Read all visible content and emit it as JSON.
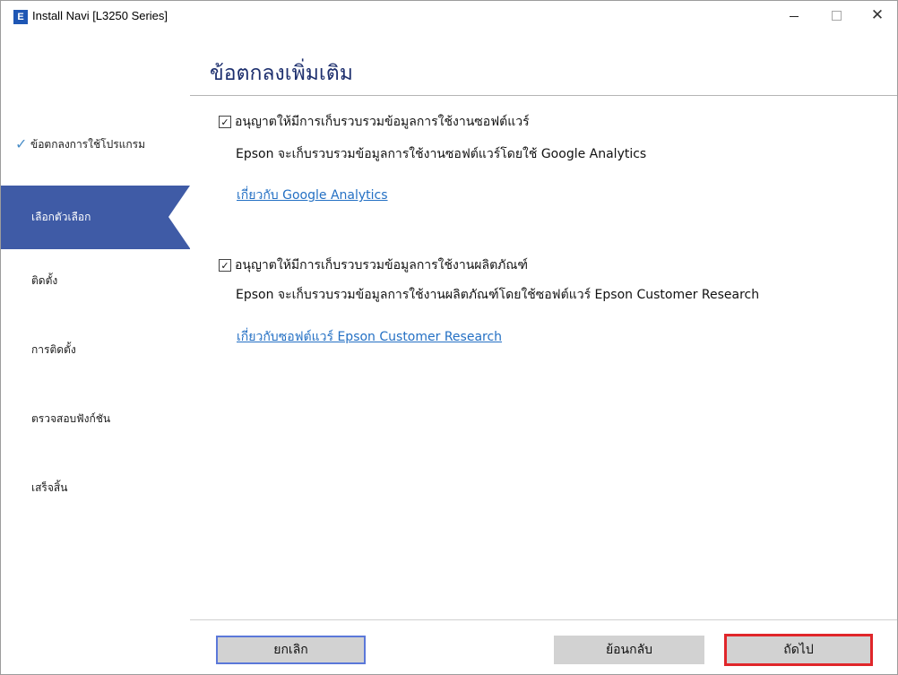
{
  "window": {
    "title": "Install Navi [L3250 Series]",
    "app_icon_letter": "E"
  },
  "sidebar": {
    "items": [
      {
        "label": "ข้อตกลงการใช้โปรแกรม",
        "state": "done"
      },
      {
        "label": "เลือกตัวเลือก",
        "state": "active"
      },
      {
        "label": "ติดตั้ง",
        "state": "pending"
      },
      {
        "label": "การติดตั้ง",
        "state": "pending"
      },
      {
        "label": "ตรวจสอบฟังก์ชัน",
        "state": "pending"
      },
      {
        "label": "เสร็จสิ้น",
        "state": "pending"
      }
    ]
  },
  "main": {
    "title": "ข้อตกลงเพิ่มเติม",
    "options": [
      {
        "checkbox_label": "อนุญาตให้มีการเก็บรวบรวมข้อมูลการใช้งานซอฟต์แวร์",
        "checked": true,
        "description": "Epson จะเก็บรวบรวมข้อมูลการใช้งานซอฟต์แวร์โดยใช้ Google Analytics",
        "link": "เกี่ยวกับ Google Analytics"
      },
      {
        "checkbox_label": "อนุญาตให้มีการเก็บรวบรวมข้อมูลการใช้งานผลิตภัณฑ์",
        "checked": true,
        "description": "Epson จะเก็บรวบรวมข้อมูลการใช้งานผลิตภัณฑ์โดยใช้ซอฟต์แวร์ Epson Customer Research",
        "link": "เกี่ยวกับซอฟต์แวร์ Epson Customer Research"
      }
    ]
  },
  "footer": {
    "cancel_label": "ยกเลิก",
    "back_label": "ย้อนกลับ",
    "next_label": "ถัดไป"
  },
  "colors": {
    "sidebar_active": "#3f5ba6",
    "title": "#1d2f6e",
    "link": "#2470c4",
    "highlight": "#e0262a"
  }
}
